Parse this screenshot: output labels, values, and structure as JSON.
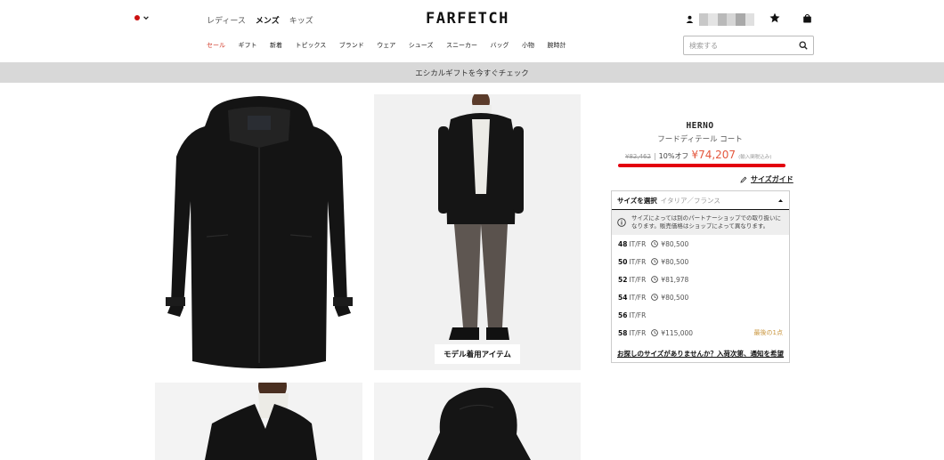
{
  "header": {
    "logo": "FARFETCH",
    "gender_tabs": [
      "レディース",
      "メンズ",
      "キッズ"
    ],
    "active_gender": "メンズ",
    "nav_items": [
      "セール",
      "ギフト",
      "新着",
      "トピックス",
      "ブランド",
      "ウェア",
      "シューズ",
      "スニーカー",
      "バッグ",
      "小物",
      "腕時計"
    ],
    "search_placeholder": "検索する",
    "flag_color": "#cc1010"
  },
  "banner": {
    "text": "エシカルギフトを今すぐチェック"
  },
  "gallery": {
    "model_label": "モデル着用アイテム"
  },
  "product": {
    "brand": "HERNO",
    "name": "フードディテール コート",
    "original_price": "¥82,462",
    "discount": "10%オフ",
    "price": "¥74,207",
    "tax_note": "(輸入関税込み)",
    "accent_color": "#e4573d",
    "size_guide": "サイズガイド"
  },
  "size_selector": {
    "label": "サイズを選択",
    "region": "イタリア／フランス",
    "info": "サイズによっては別のパートナーショップでの取り扱いになります。販売価格はショップによって異なります。",
    "sizes": [
      {
        "size": "48",
        "unit": "IT/FR",
        "price": "¥80,500",
        "note": ""
      },
      {
        "size": "50",
        "unit": "IT/FR",
        "price": "¥80,500",
        "note": ""
      },
      {
        "size": "52",
        "unit": "IT/FR",
        "price": "¥81,978",
        "note": ""
      },
      {
        "size": "54",
        "unit": "IT/FR",
        "price": "¥80,500",
        "note": ""
      },
      {
        "size": "56",
        "unit": "IT/FR",
        "price": "",
        "note": ""
      },
      {
        "size": "58",
        "unit": "IT/FR",
        "price": "¥115,000",
        "note": "最後の1点"
      }
    ],
    "notify_link": "お探しのサイズがありませんか？入荷次第、通知を希望"
  }
}
